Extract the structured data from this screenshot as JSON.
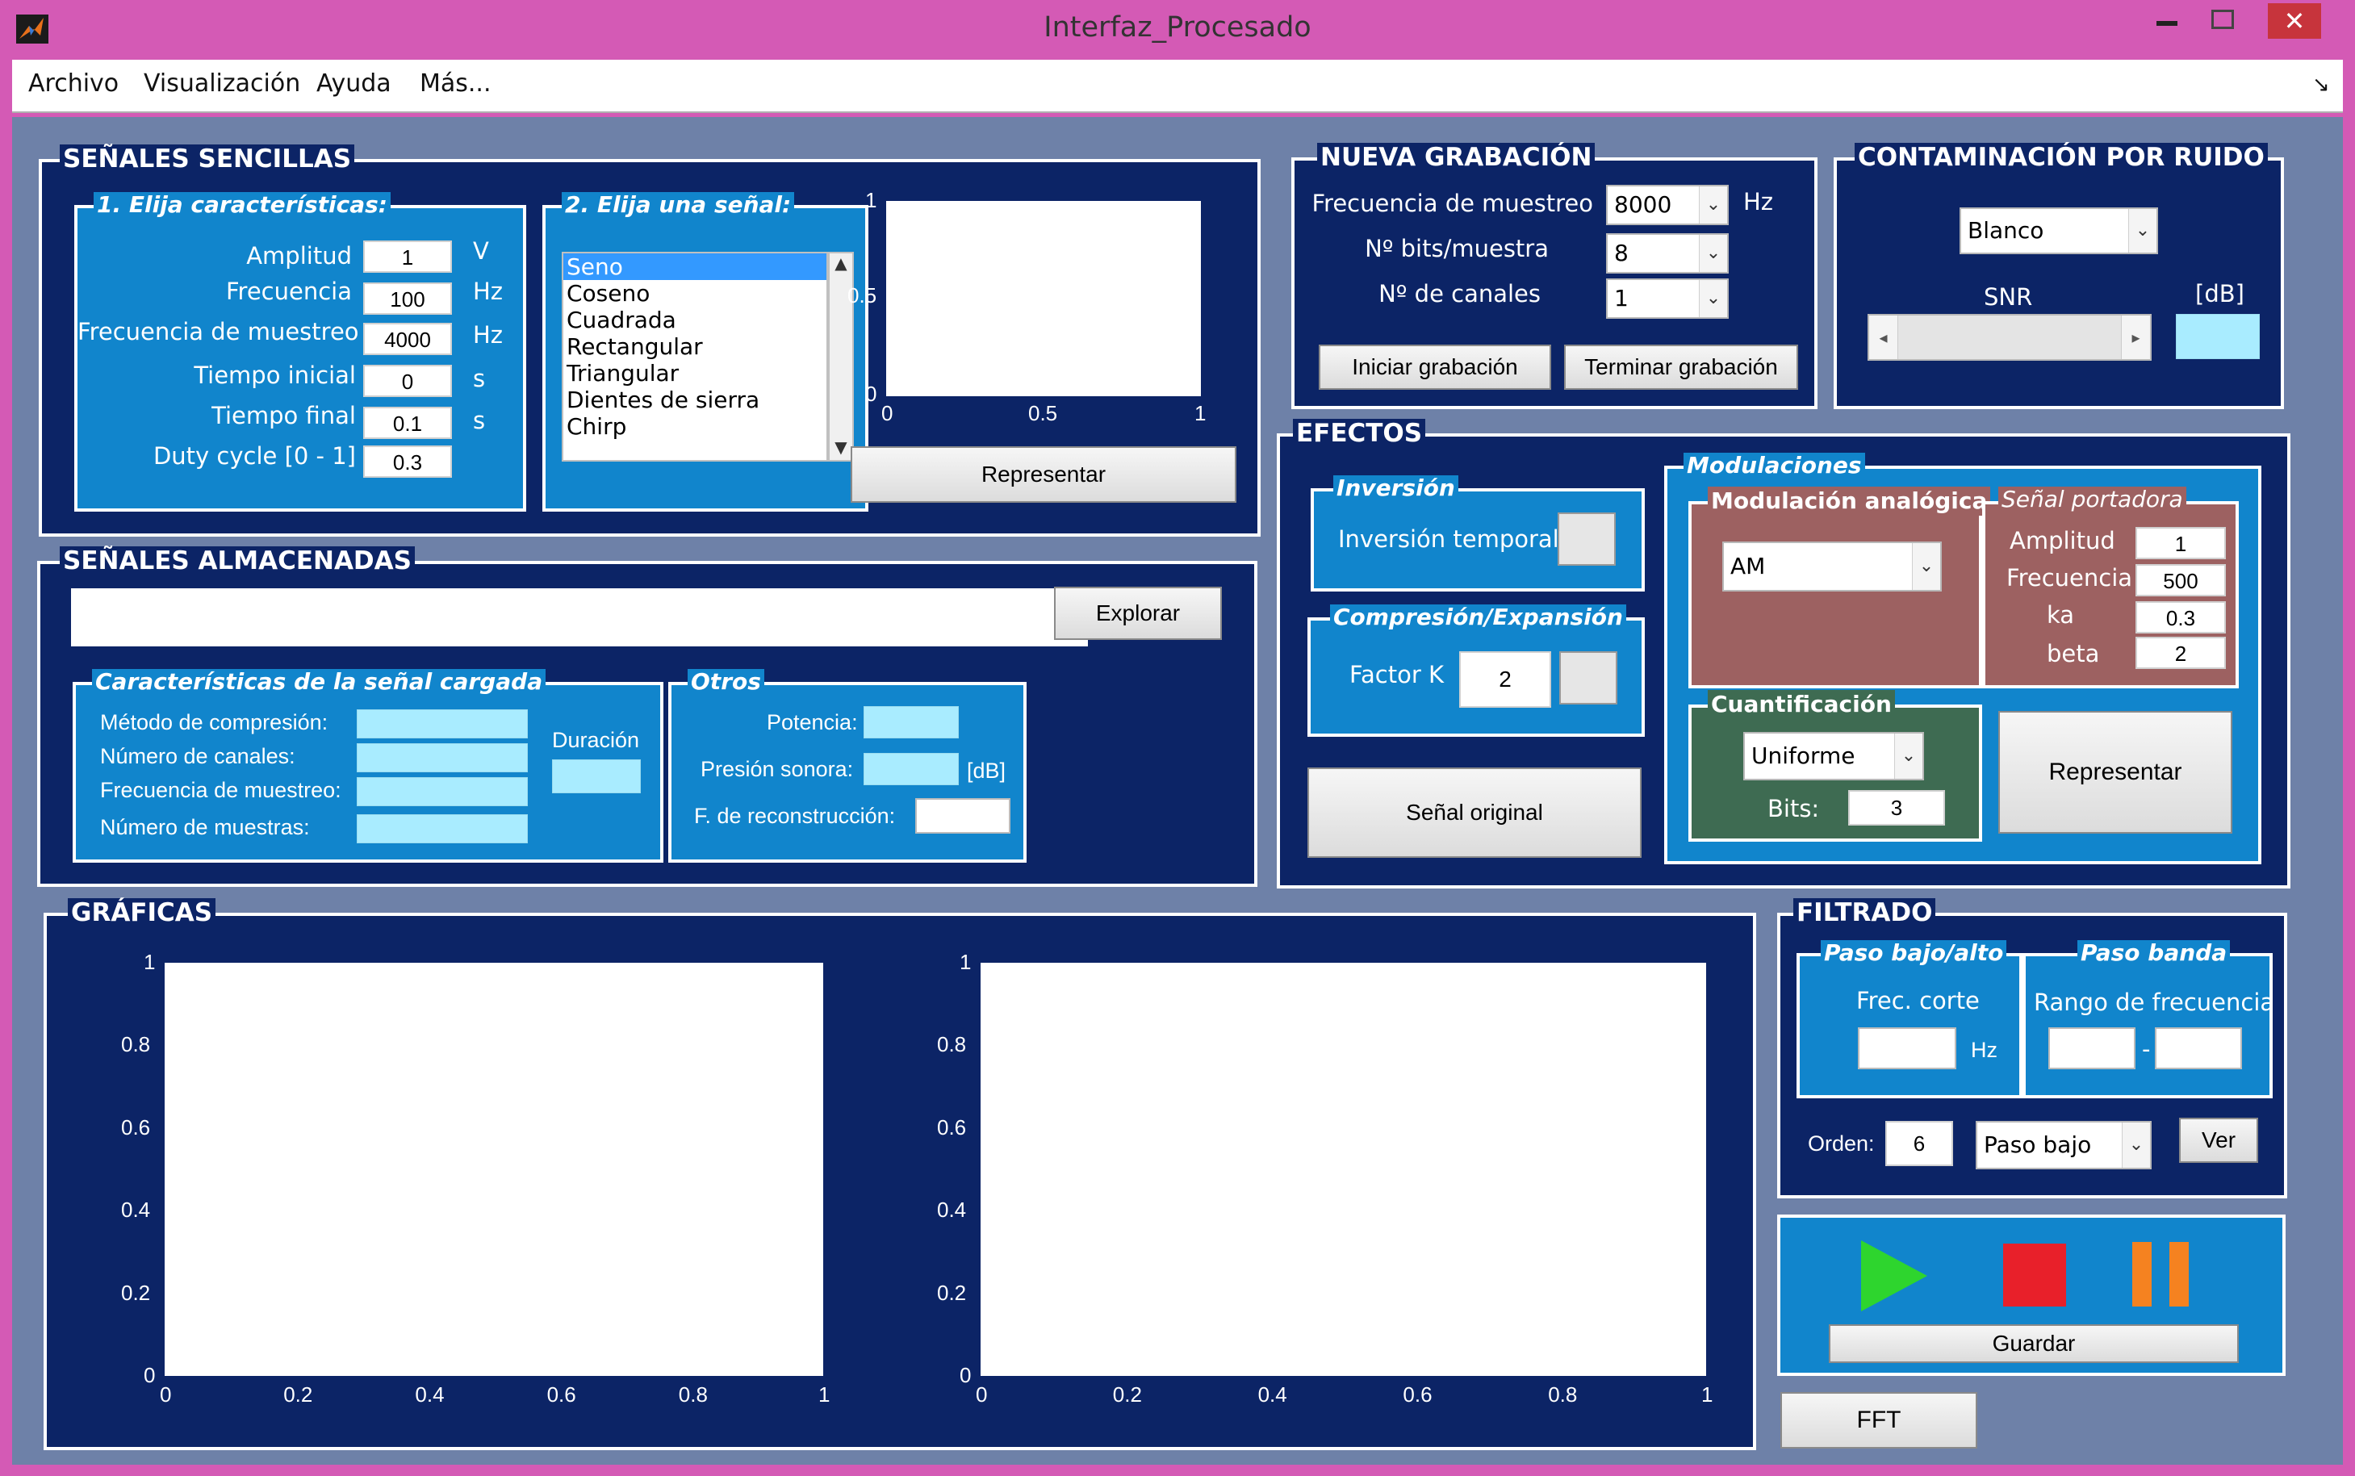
{
  "window": {
    "title": "Interfaz_Procesado",
    "icon": "matlab-icon",
    "controls": [
      "minimize-icon",
      "maximize-icon",
      "close-icon"
    ]
  },
  "menu": {
    "items": [
      "Archivo",
      "Visualización",
      "Ayuda",
      "Más..."
    ]
  },
  "simple": {
    "title": "SEÑALES SENCILLAS",
    "chars_title": "1. Elija características:",
    "amp_label": "Amplitud",
    "amp_value": "1",
    "amp_unit": "V",
    "freq_label": "Frecuencia",
    "freq_value": "100",
    "freq_unit": "Hz",
    "fs_label": "Frecuencia de muestreo",
    "fs_value": "4000",
    "fs_unit": "Hz",
    "t0_label": "Tiempo inicial",
    "t0_value": "0",
    "t0_unit": "s",
    "tf_label": "Tiempo final",
    "tf_value": "0.1",
    "tf_unit": "s",
    "duty_label": "Duty cycle [0 - 1]",
    "duty_value": "0.3",
    "signal_title": "2. Elija una señal:",
    "signals": [
      "Seno",
      "Coseno",
      "Cuadrada",
      "Rectangular",
      "Triangular",
      "Dientes de sierra",
      "Chirp"
    ],
    "selected_signal": "Seno",
    "plot_x_ticks": [
      "0",
      "0.5",
      "1"
    ],
    "plot_y_ticks": [
      "1",
      "0.5",
      "0"
    ],
    "represent_button": "Representar"
  },
  "recording": {
    "title": "NUEVA GRABACIÓN",
    "fs_label": "Frecuencia de muestreo",
    "fs_value": "8000",
    "fs_unit": "Hz",
    "bits_label": "Nº bits/muestra",
    "bits_value": "8",
    "channels_label": "Nº de canales",
    "channels_value": "1",
    "start_button": "Iniciar grabación",
    "stop_button": "Terminar grabación"
  },
  "noise": {
    "title": "CONTAMINACIÓN POR RUIDO",
    "type_value": "Blanco",
    "snr_label": "SNR",
    "db_label": "[dB]"
  },
  "stored": {
    "title": "SEÑALES ALMACENADAS",
    "explore_button": "Explorar",
    "chars_title": "Características de la señal cargada",
    "compression_label": "Método de compresión:",
    "channels_label": "Número de canales:",
    "fs_label": "Frecuencia de muestreo:",
    "samples_label": "Número de muestras:",
    "duration_label": "Duración",
    "others_title": "Otros",
    "power_label": "Potencia:",
    "pressure_label": "Presión sonora:",
    "pressure_unit": "[dB]",
    "recon_label": "F. de reconstrucción:"
  },
  "effects": {
    "title": "EFECTOS",
    "inversion_title": "Inversión",
    "inversion_label": "Inversión temporal",
    "compression_title": "Compresión/Expansión",
    "factor_label": "Factor K",
    "factor_value": "2",
    "original_button": "Señal original",
    "modulations_title": "Modulaciones",
    "analog_title": "Modulación analógica",
    "analog_value": "AM",
    "carrier_title": "Señal portadora",
    "c_amp_label": "Amplitud",
    "c_amp_value": "1",
    "c_freq_label": "Frecuencia",
    "c_freq_value": "500",
    "ka_label": "ka",
    "ka_value": "0.3",
    "beta_label": "beta",
    "beta_value": "2",
    "quant_title": "Cuantificación",
    "quant_value": "Uniforme",
    "bits_label": "Bits:",
    "bits_value": "3",
    "represent_button": "Representar"
  },
  "graphs": {
    "title": "GRÁFICAS",
    "plot1_x_ticks": [
      "0",
      "0.2",
      "0.4",
      "0.6",
      "0.8",
      "1"
    ],
    "plot1_y_ticks": [
      "1",
      "0.8",
      "0.6",
      "0.4",
      "0.2",
      "0"
    ],
    "plot2_x_ticks": [
      "0",
      "0.2",
      "0.4",
      "0.6",
      "0.8",
      "1"
    ],
    "plot2_y_ticks": [
      "1",
      "0.8",
      "0.6",
      "0.4",
      "0.2",
      "0"
    ]
  },
  "filter": {
    "title": "FILTRADO",
    "lowhigh_title": "Paso bajo/alto",
    "cutoff_label": "Frec. corte",
    "cutoff_unit": "Hz",
    "band_title": "Paso banda",
    "range_label": "Rango de frecuencia",
    "range_sep": "-",
    "order_label": "Orden:",
    "order_value": "6",
    "type_value": "Paso bajo",
    "view_button": "Ver"
  },
  "player": {
    "play_icon": "play-icon",
    "stop_icon": "stop-icon",
    "pause_icon": "pause-icon",
    "play_color": "#2ed52e",
    "stop_color": "#e8202a",
    "pause_color": "#f58220",
    "save_button": "Guardar"
  },
  "fft_button": "FFT",
  "colors": {
    "navy": "#0c2466",
    "panel_blue": "#1185cc",
    "modulation": "#9d6161",
    "quantization": "#3e6b52",
    "window_frame": "#d45ab5",
    "background": "#6e81a8"
  }
}
